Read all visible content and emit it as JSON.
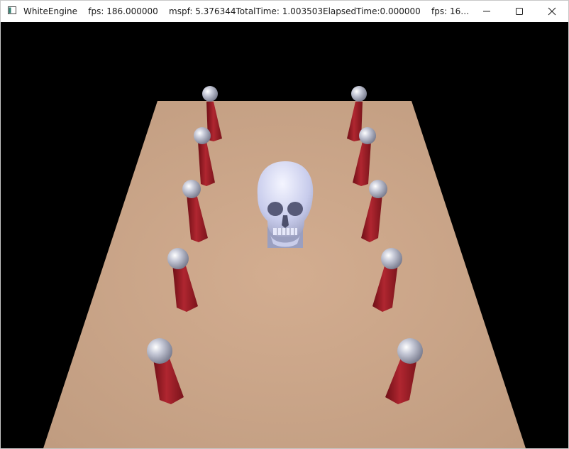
{
  "window": {
    "title": "WhiteEngine    fps: 186.000000    mspf: 5.376344TotalTime: 1.003503ElapsedTime:0.000000    fps: 165.000000    mspf: 6....",
    "controls": {
      "minimize": "minimize-icon",
      "maximize": "maximize-icon",
      "close": "close-icon"
    }
  },
  "scene": {
    "background_color": "#000000",
    "floor_color": "#c8a487",
    "pillar_color": "#9b1c24",
    "sphere_color": "#b4b8c8",
    "skull_color": "#d4d8f0",
    "objects": [
      "floor",
      "skull",
      "pillars-with-spheres"
    ]
  }
}
